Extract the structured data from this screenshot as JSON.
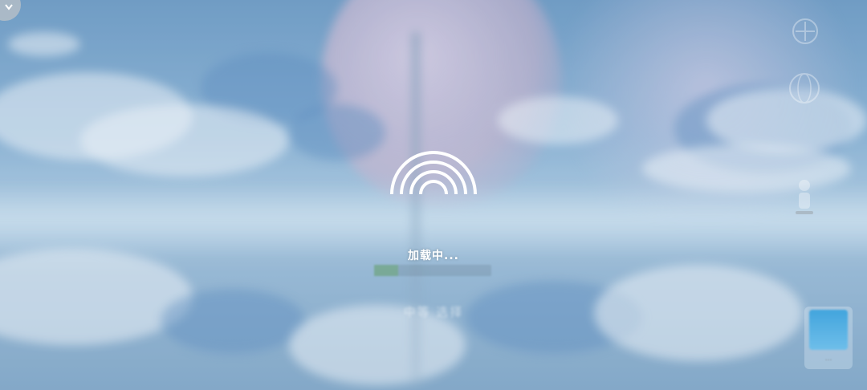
{
  "loading": {
    "text": "加载中...",
    "icon": "rainbow-arcs-icon"
  },
  "background": {
    "faded_text": "中等 选择",
    "thumbnail_label": "..."
  },
  "icons": {
    "back": "chevron-icon",
    "top_right": "compass-icon",
    "mid_right": "globe-icon",
    "right_side": "figure-icon"
  },
  "colors": {
    "sky": "#8fb6d6",
    "overlay_text": "#ffffff",
    "thumb": "#3ba4df"
  }
}
